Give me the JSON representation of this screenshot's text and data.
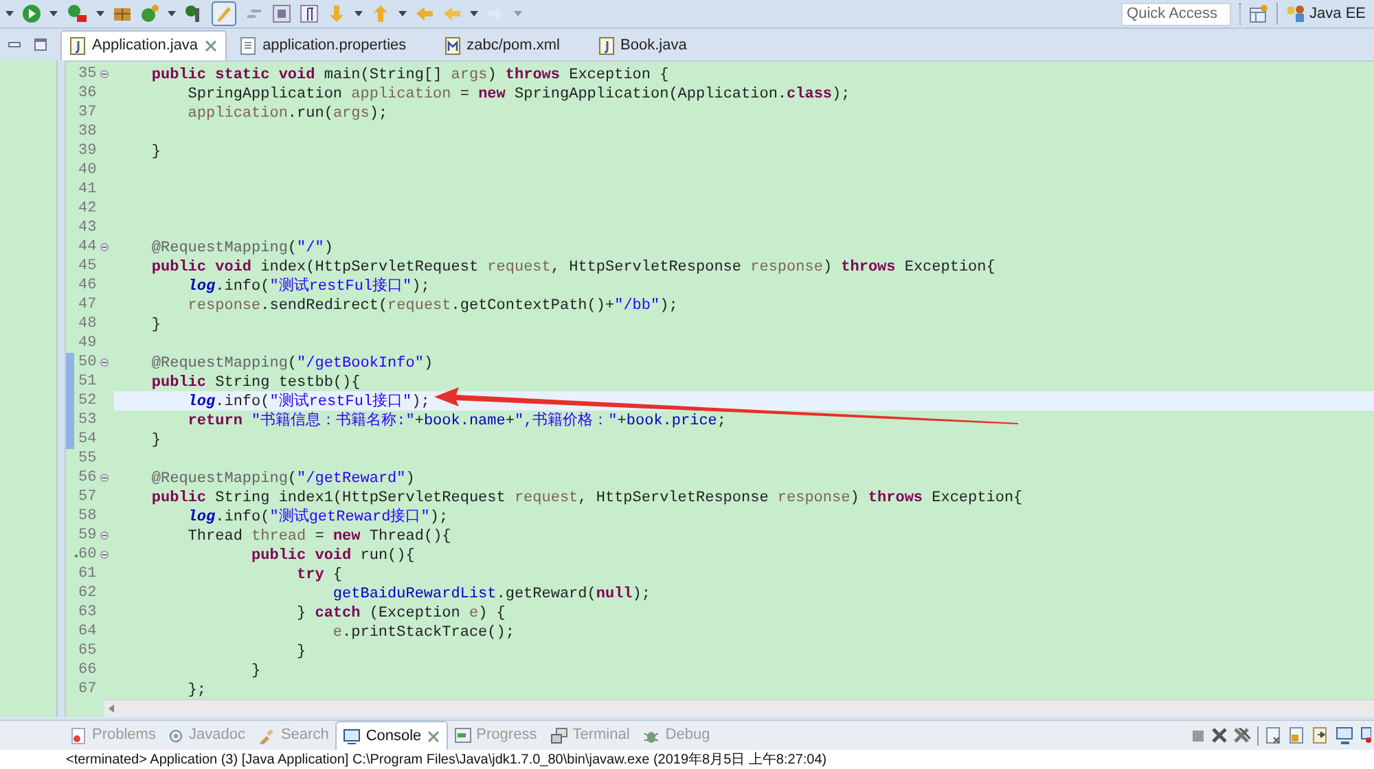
{
  "toolbar": {
    "quick_access": {
      "placeholder": "Quick Access"
    },
    "perspective": "Java EE"
  },
  "editor_tabs": [
    {
      "label": "Application.java",
      "selected": true
    },
    {
      "label": "application.properties",
      "selected": false
    },
    {
      "label": "zabc/pom.xml",
      "selected": false
    },
    {
      "label": "Book.java",
      "selected": false
    }
  ],
  "code": {
    "lines": [
      {
        "number": "35",
        "fold": true,
        "changed": false,
        "current": false,
        "override": false,
        "tokens": [
          {
            "kind": "keyword",
            "text": "    public"
          },
          {
            "kind": "keyword",
            "text": " static"
          },
          {
            "kind": "keyword",
            "text": " void"
          },
          {
            "kind": "text",
            "text": " main(String[] "
          },
          {
            "kind": "variable",
            "text": "args"
          },
          {
            "kind": "text",
            "text": ") "
          },
          {
            "kind": "keyword",
            "text": "throws"
          },
          {
            "kind": "text",
            "text": " Exception {"
          }
        ]
      },
      {
        "number": "36",
        "fold": false,
        "changed": false,
        "current": false,
        "override": false,
        "tokens": [
          {
            "kind": "text",
            "text": "        SpringApplication "
          },
          {
            "kind": "variable",
            "text": "application"
          },
          {
            "kind": "text",
            "text": " = "
          },
          {
            "kind": "keyword",
            "text": "new"
          },
          {
            "kind": "text",
            "text": " SpringApplication(Application."
          },
          {
            "kind": "keyword",
            "text": "class"
          },
          {
            "kind": "text",
            "text": ");"
          }
        ]
      },
      {
        "number": "37",
        "fold": false,
        "changed": false,
        "current": false,
        "override": false,
        "tokens": [
          {
            "kind": "variable",
            "text": "        application"
          },
          {
            "kind": "text",
            "text": ".run("
          },
          {
            "kind": "variable",
            "text": "args"
          },
          {
            "kind": "text",
            "text": ");"
          }
        ]
      },
      {
        "number": "38",
        "fold": false,
        "changed": false,
        "current": false,
        "override": false
      },
      {
        "number": "39",
        "fold": false,
        "changed": false,
        "current": false,
        "override": false,
        "tokens": [
          {
            "kind": "text",
            "text": "    }"
          }
        ]
      },
      {
        "number": "40",
        "fold": false,
        "changed": false,
        "current": false,
        "override": false
      },
      {
        "number": "41",
        "fold": false,
        "changed": false,
        "current": false,
        "override": false
      },
      {
        "number": "42",
        "fold": false,
        "changed": false,
        "current": false,
        "override": false
      },
      {
        "number": "43",
        "fold": false,
        "changed": false,
        "current": false,
        "override": false
      },
      {
        "number": "44",
        "fold": true,
        "changed": false,
        "current": false,
        "override": false,
        "tokens": [
          {
            "kind": "annotation",
            "text": "    @RequestMapping"
          },
          {
            "kind": "text",
            "text": "("
          },
          {
            "kind": "string",
            "text": "\"/\""
          },
          {
            "kind": "text",
            "text": ")"
          }
        ]
      },
      {
        "number": "45",
        "fold": false,
        "changed": false,
        "current": false,
        "override": false,
        "tokens": [
          {
            "kind": "keyword",
            "text": "    public"
          },
          {
            "kind": "keyword",
            "text": " void"
          },
          {
            "kind": "text",
            "text": " index(HttpServletRequest "
          },
          {
            "kind": "variable",
            "text": "request"
          },
          {
            "kind": "text",
            "text": ", HttpServletResponse "
          },
          {
            "kind": "variable",
            "text": "response"
          },
          {
            "kind": "text",
            "text": ") "
          },
          {
            "kind": "keyword",
            "text": "throws"
          },
          {
            "kind": "text",
            "text": " Exception{"
          }
        ]
      },
      {
        "number": "46",
        "fold": false,
        "changed": false,
        "current": false,
        "override": false,
        "tokens": [
          {
            "kind": "static_field",
            "text": "        log"
          },
          {
            "kind": "text",
            "text": ".info("
          },
          {
            "kind": "string",
            "text": "\"测试restFul接口\""
          },
          {
            "kind": "text",
            "text": ");"
          }
        ]
      },
      {
        "number": "47",
        "fold": false,
        "changed": false,
        "current": false,
        "override": false,
        "tokens": [
          {
            "kind": "variable",
            "text": "        response"
          },
          {
            "kind": "text",
            "text": ".sendRedirect("
          },
          {
            "kind": "variable",
            "text": "request"
          },
          {
            "kind": "text",
            "text": ".getContextPath()+"
          },
          {
            "kind": "string",
            "text": "\"/bb\""
          },
          {
            "kind": "text",
            "text": ");"
          }
        ]
      },
      {
        "number": "48",
        "fold": false,
        "changed": false,
        "current": false,
        "override": false,
        "tokens": [
          {
            "kind": "text",
            "text": "    }"
          }
        ]
      },
      {
        "number": "49",
        "fold": false,
        "changed": false,
        "current": false,
        "override": false
      },
      {
        "number": "50",
        "fold": true,
        "changed": true,
        "current": false,
        "override": false,
        "tokens": [
          {
            "kind": "annotation",
            "text": "    @RequestMapping"
          },
          {
            "kind": "text",
            "text": "("
          },
          {
            "kind": "string",
            "text": "\"/getBookInfo\""
          },
          {
            "kind": "text",
            "text": ")"
          }
        ]
      },
      {
        "number": "51",
        "fold": false,
        "changed": true,
        "current": false,
        "override": false,
        "tokens": [
          {
            "kind": "keyword",
            "text": "    public"
          },
          {
            "kind": "text",
            "text": " String testbb(){"
          }
        ]
      },
      {
        "number": "52",
        "fold": false,
        "changed": true,
        "current": true,
        "override": false,
        "tokens": [
          {
            "kind": "static_field",
            "text": "        log"
          },
          {
            "kind": "text",
            "text": ".info("
          },
          {
            "kind": "string",
            "text": "\"测试restFul接口\""
          },
          {
            "kind": "text",
            "text": ");"
          }
        ]
      },
      {
        "number": "53",
        "fold": false,
        "changed": true,
        "current": false,
        "override": false,
        "tokens": [
          {
            "kind": "keyword",
            "text": "        return"
          },
          {
            "kind": "string",
            "text": " \"书籍信息：书籍名称:\""
          },
          {
            "kind": "text",
            "text": "+"
          },
          {
            "kind": "field",
            "text": "book.name"
          },
          {
            "kind": "text",
            "text": "+"
          },
          {
            "kind": "string",
            "text": "\",书籍价格：\""
          },
          {
            "kind": "text",
            "text": "+"
          },
          {
            "kind": "field",
            "text": "book.price"
          },
          {
            "kind": "text",
            "text": ";"
          }
        ]
      },
      {
        "number": "54",
        "fold": false,
        "changed": true,
        "current": false,
        "override": false,
        "tokens": [
          {
            "kind": "text",
            "text": "    }"
          }
        ]
      },
      {
        "number": "55",
        "fold": false,
        "changed": false,
        "current": false,
        "override": false
      },
      {
        "number": "56",
        "fold": true,
        "changed": false,
        "current": false,
        "override": false,
        "tokens": [
          {
            "kind": "annotation",
            "text": "    @RequestMapping"
          },
          {
            "kind": "text",
            "text": "("
          },
          {
            "kind": "string",
            "text": "\"/getReward\""
          },
          {
            "kind": "text",
            "text": ")"
          }
        ]
      },
      {
        "number": "57",
        "fold": false,
        "changed": false,
        "current": false,
        "override": false,
        "tokens": [
          {
            "kind": "keyword",
            "text": "    public"
          },
          {
            "kind": "text",
            "text": " String index1(HttpServletRequest "
          },
          {
            "kind": "variable",
            "text": "request"
          },
          {
            "kind": "text",
            "text": ", HttpServletResponse "
          },
          {
            "kind": "variable",
            "text": "response"
          },
          {
            "kind": "text",
            "text": ") "
          },
          {
            "kind": "keyword",
            "text": "throws"
          },
          {
            "kind": "text",
            "text": " Exception{"
          }
        ]
      },
      {
        "number": "58",
        "fold": false,
        "changed": false,
        "current": false,
        "override": false,
        "tokens": [
          {
            "kind": "static_field",
            "text": "        log"
          },
          {
            "kind": "text",
            "text": ".info("
          },
          {
            "kind": "string",
            "text": "\"测试getReward接口\""
          },
          {
            "kind": "text",
            "text": ");"
          }
        ]
      },
      {
        "number": "59",
        "fold": true,
        "changed": false,
        "current": false,
        "override": false,
        "tokens": [
          {
            "kind": "text",
            "text": "        Thread "
          },
          {
            "kind": "variable",
            "text": "thread"
          },
          {
            "kind": "text",
            "text": " = "
          },
          {
            "kind": "keyword",
            "text": "new"
          },
          {
            "kind": "text",
            "text": " Thread(){"
          }
        ]
      },
      {
        "number": "60",
        "fold": true,
        "changed": false,
        "current": false,
        "override": true,
        "tokens": [
          {
            "kind": "keyword",
            "text": "               public"
          },
          {
            "kind": "keyword",
            "text": " void"
          },
          {
            "kind": "text",
            "text": " run(){"
          }
        ]
      },
      {
        "number": "61",
        "fold": false,
        "changed": false,
        "current": false,
        "override": false,
        "tokens": [
          {
            "kind": "keyword",
            "text": "                    try"
          },
          {
            "kind": "text",
            "text": " {"
          }
        ]
      },
      {
        "number": "62",
        "fold": false,
        "changed": false,
        "current": false,
        "override": false,
        "tokens": [
          {
            "kind": "field",
            "text": "                        getBaiduRewardList"
          },
          {
            "kind": "text",
            "text": ".getReward("
          },
          {
            "kind": "keyword",
            "text": "null"
          },
          {
            "kind": "text",
            "text": ");"
          }
        ]
      },
      {
        "number": "63",
        "fold": false,
        "changed": false,
        "current": false,
        "override": false,
        "tokens": [
          {
            "kind": "text",
            "text": "                    } "
          },
          {
            "kind": "keyword",
            "text": "catch"
          },
          {
            "kind": "text",
            "text": " (Exception "
          },
          {
            "kind": "variable",
            "text": "e"
          },
          {
            "kind": "text",
            "text": ") {"
          }
        ]
      },
      {
        "number": "64",
        "fold": false,
        "changed": false,
        "current": false,
        "override": false,
        "tokens": [
          {
            "kind": "variable",
            "text": "                        e"
          },
          {
            "kind": "text",
            "text": ".printStackTrace();"
          }
        ]
      },
      {
        "number": "65",
        "fold": false,
        "changed": false,
        "current": false,
        "override": false,
        "tokens": [
          {
            "kind": "text",
            "text": "                    }"
          }
        ]
      },
      {
        "number": "66",
        "fold": false,
        "changed": false,
        "current": false,
        "override": false,
        "tokens": [
          {
            "kind": "text",
            "text": "               }"
          }
        ]
      },
      {
        "number": "67",
        "fold": false,
        "changed": false,
        "current": false,
        "override": false,
        "tokens": [
          {
            "kind": "text",
            "text": "        };"
          }
        ]
      }
    ]
  },
  "bottom_tabs": [
    {
      "label": "Problems",
      "selected": false
    },
    {
      "label": "Javadoc",
      "selected": false
    },
    {
      "label": "Search",
      "selected": false
    },
    {
      "label": "Console",
      "selected": true
    },
    {
      "label": "Progress",
      "selected": false
    },
    {
      "label": "Terminal",
      "selected": false
    },
    {
      "label": "Debug",
      "selected": false
    }
  ],
  "console": {
    "status": "<terminated> Application (3) [Java Application] C:\\Program Files\\Java\\jdk1.7.0_80\\bin\\javaw.exe (2019年8月5日 上午8:27:04)"
  }
}
